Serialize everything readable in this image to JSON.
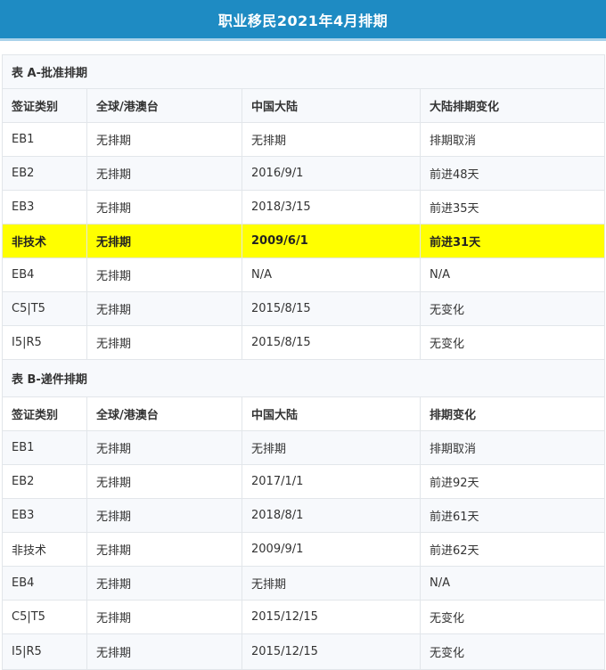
{
  "header": {
    "title": "职业移民2021年4月排期"
  },
  "table_a": {
    "title": "表 A-批准排期",
    "headers": [
      "签证类别",
      "全球/港澳台",
      "中国大陆",
      "大陆排期变化"
    ],
    "rows": [
      [
        "EB1",
        "无排期",
        "无排期",
        "排期取消"
      ],
      [
        "EB2",
        "无排期",
        "2016/9/1",
        "前进48天"
      ],
      [
        "EB3",
        "无排期",
        "2018/3/15",
        "前进35天"
      ],
      [
        "非技术",
        "无排期",
        "2009/6/1",
        "前进31天"
      ],
      [
        "EB4",
        "无排期",
        "N/A",
        "N/A"
      ],
      [
        "C5|T5",
        "无排期",
        "2015/8/15",
        "无变化"
      ],
      [
        "I5|R5",
        "无排期",
        "2015/8/15",
        "无变化"
      ]
    ],
    "highlight_color": "#ffff00"
  },
  "table_b": {
    "title": "表 B-递件排期",
    "headers": [
      "签证类别",
      "全球/港澳台",
      "中国大陆",
      "排期变化"
    ],
    "rows": [
      [
        "EB1",
        "无排期",
        "无排期",
        "排期取消"
      ],
      [
        "EB2",
        "无排期",
        "2017/1/1",
        "前进92天"
      ],
      [
        "EB3",
        "无排期",
        "2018/8/1",
        "前进61天"
      ],
      [
        "非技术",
        "无排期",
        "2009/9/1",
        "前进62天"
      ],
      [
        "EB4",
        "无排期",
        "无排期",
        "N/A"
      ],
      [
        "C5|T5",
        "无排期",
        "2015/12/15",
        "无变化"
      ],
      [
        "I5|R5",
        "无排期",
        "2015/12/15",
        "无变化"
      ]
    ]
  },
  "colors": {
    "header_bg": "#1e8bc3",
    "alt_row_bg": "#f7f9fc",
    "border": "#e2e6ea"
  }
}
